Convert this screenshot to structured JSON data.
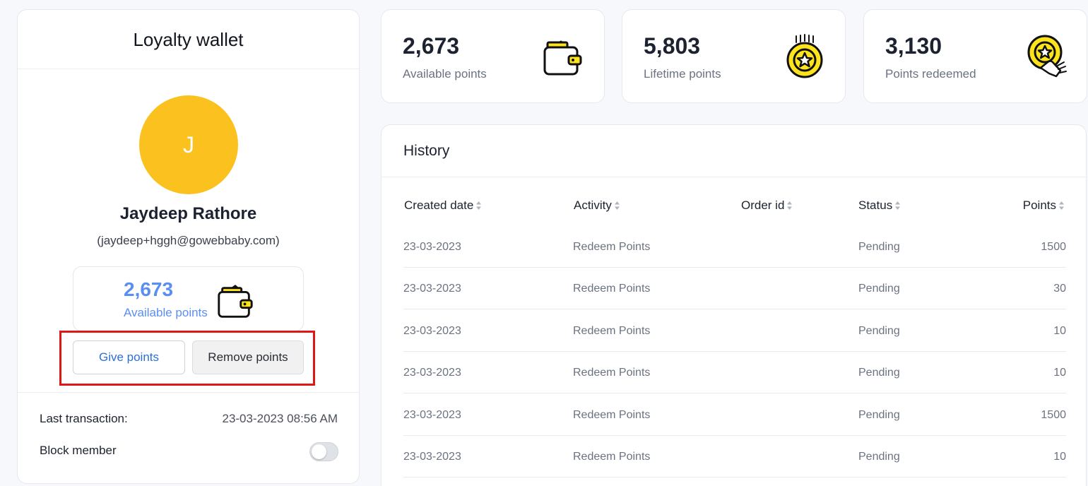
{
  "wallet": {
    "title": "Loyalty wallet",
    "avatar_letter": "J",
    "avatar_color": "#fbc21f",
    "member_name": "Jaydeep Rathore",
    "member_email": "(jaydeep+hggh@gowebbaby.com)",
    "balance_value": "2,673",
    "balance_label": "Available points",
    "give_button": "Give points",
    "remove_button": "Remove points",
    "last_transaction_label": "Last transaction:",
    "last_transaction_value": "23-03-2023 08:56 AM",
    "block_member_label": "Block member",
    "block_member_on": false
  },
  "stats": [
    {
      "value": "2,673",
      "label": "Available points",
      "icon": "wallet-icon"
    },
    {
      "value": "5,803",
      "label": "Lifetime points",
      "icon": "star-coin-icon"
    },
    {
      "value": "3,130",
      "label": "Points redeemed",
      "icon": "redeem-coin-icon"
    }
  ],
  "history": {
    "title": "History",
    "columns": [
      "Created date",
      "Activity",
      "Order id",
      "Status",
      "Points"
    ],
    "rows": [
      {
        "date": "23-03-2023",
        "activity": "Redeem Points",
        "order_id": "",
        "status": "Pending",
        "points": "1500"
      },
      {
        "date": "23-03-2023",
        "activity": "Redeem Points",
        "order_id": "",
        "status": "Pending",
        "points": "30"
      },
      {
        "date": "23-03-2023",
        "activity": "Redeem Points",
        "order_id": "",
        "status": "Pending",
        "points": "10"
      },
      {
        "date": "23-03-2023",
        "activity": "Redeem Points",
        "order_id": "",
        "status": "Pending",
        "points": "10"
      },
      {
        "date": "23-03-2023",
        "activity": "Redeem Points",
        "order_id": "",
        "status": "Pending",
        "points": "1500"
      },
      {
        "date": "23-03-2023",
        "activity": "Redeem Points",
        "order_id": "",
        "status": "Pending",
        "points": "10"
      }
    ]
  },
  "colors": {
    "accent_blue": "#5a8ff2",
    "highlight_red": "#e01717",
    "coin_yellow": "#fde31b"
  }
}
